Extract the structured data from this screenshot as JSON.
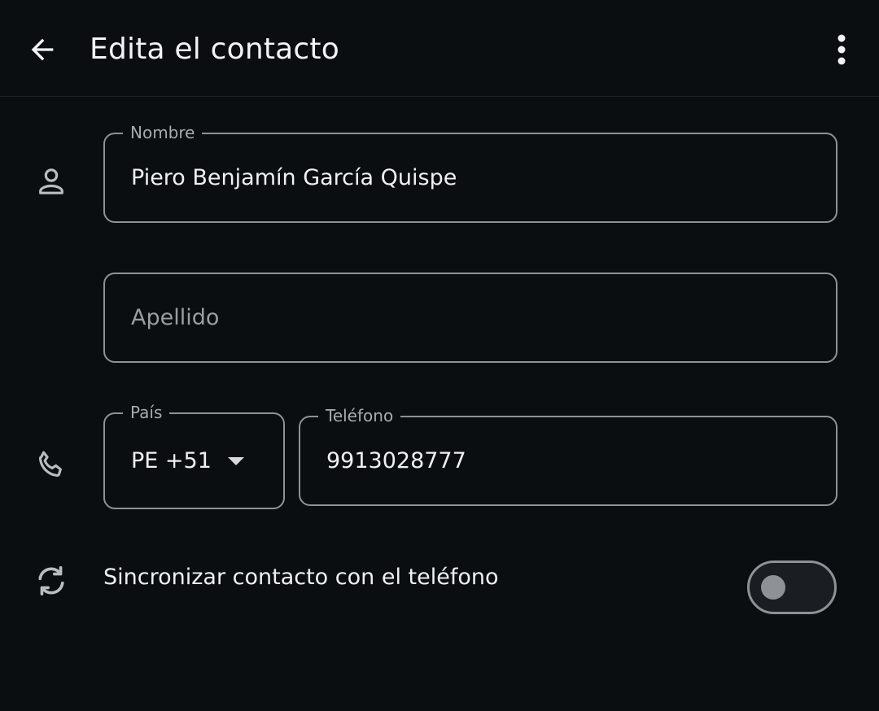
{
  "appbar": {
    "title": "Edita el contacto",
    "back_icon": "arrow-back-icon",
    "menu_icon": "more-vert-icon"
  },
  "form": {
    "name": {
      "label": "Nombre",
      "value": "Piero Benjamín García Quispe",
      "icon": "person-icon"
    },
    "surname": {
      "placeholder": "Apellido"
    },
    "country": {
      "label": "País",
      "value": "PE +51",
      "icon": "phone-icon"
    },
    "phone": {
      "label": "Teléfono",
      "value": "9913028777"
    },
    "sync": {
      "label": "Sincronizar contacto con el teléfono",
      "enabled": false,
      "icon": "sync-icon"
    }
  },
  "colors": {
    "background": "#0b0e11",
    "outline": "#8e9297",
    "text": "#eef0f2"
  }
}
